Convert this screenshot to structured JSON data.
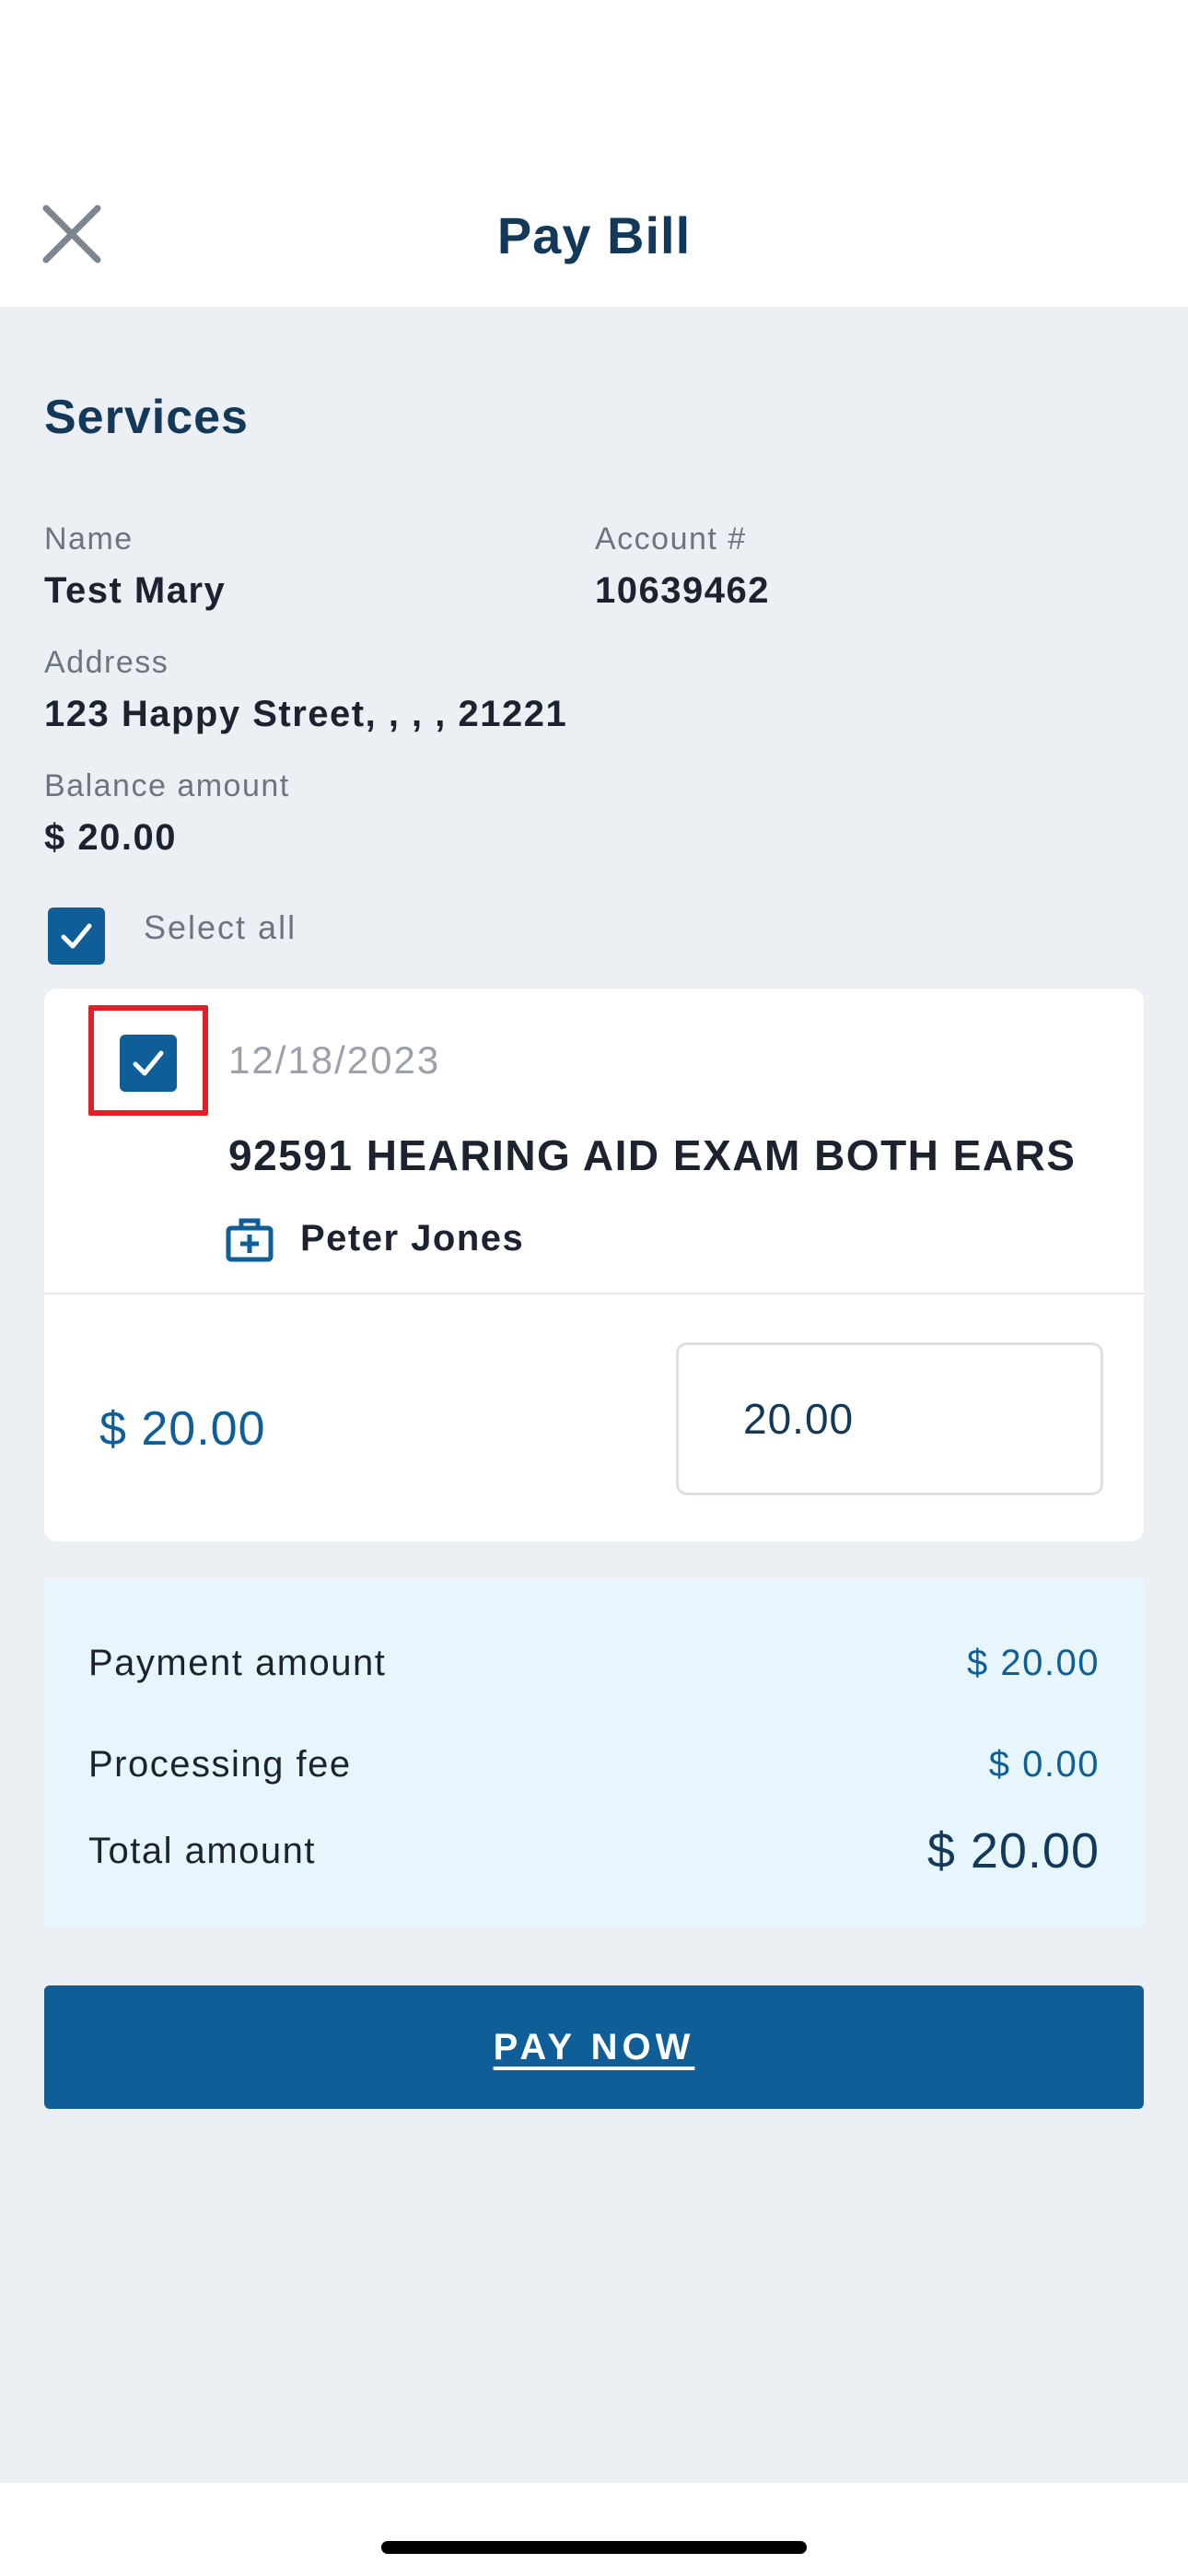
{
  "header": {
    "title": "Pay Bill"
  },
  "services": {
    "title": "Services",
    "name_label": "Name",
    "name_value": "Test Mary",
    "account_label": "Account #",
    "account_value": "10639462",
    "address_label": "Address",
    "address_value": "123 Happy Street, , , , 21221",
    "balance_label": "Balance amount",
    "balance_value": "$ 20.00",
    "select_all_label": "Select all",
    "select_all_checked": true
  },
  "bill_items": [
    {
      "checked": true,
      "date": "12/18/2023",
      "service": "92591 HEARING AID EXAM BOTH EARS",
      "provider": "Peter Jones",
      "amount": "$ 20.00",
      "pay_amount_input": "20.00"
    }
  ],
  "summary": {
    "payment_label": "Payment amount",
    "payment_value": "$ 20.00",
    "fee_label": "Processing fee",
    "fee_value": "$ 0.00",
    "total_label": "Total amount",
    "total_value": "$ 20.00"
  },
  "pay_button_label": "PAY NOW",
  "icons": {
    "close": "close-icon",
    "checkbox": "checkmark-icon",
    "provider": "medical-kit-icon"
  },
  "colors": {
    "primary": "#0f5e97",
    "title": "#13395a",
    "background": "#eceff3",
    "summary_bg": "#e7f6fd",
    "highlight": "#e02027"
  }
}
